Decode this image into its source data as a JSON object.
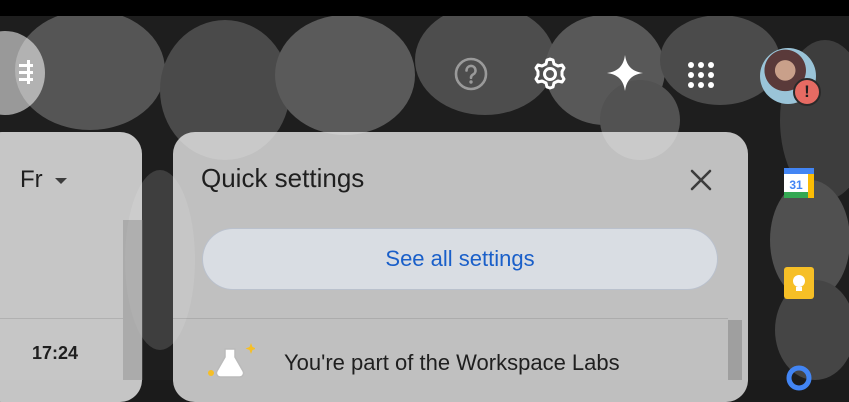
{
  "header": {
    "icons": [
      "help-icon",
      "gear-icon",
      "gemini-icon",
      "apps-grid-icon",
      "avatar"
    ],
    "avatar_alert": "!"
  },
  "left_panel": {
    "language_label": "Fr",
    "time": "17:24"
  },
  "quick_settings": {
    "title": "Quick settings",
    "see_all_label": "See all settings",
    "labs_text": "You're part of the Workspace Labs"
  },
  "side_panel": {
    "calendar_day": "31",
    "apps": [
      "calendar-icon",
      "keep-icon",
      "contacts-icon"
    ]
  },
  "colors": {
    "link_blue": "#1a5fc9",
    "alert_red": "#e66b63",
    "keep_yellow": "#f6bf26"
  }
}
